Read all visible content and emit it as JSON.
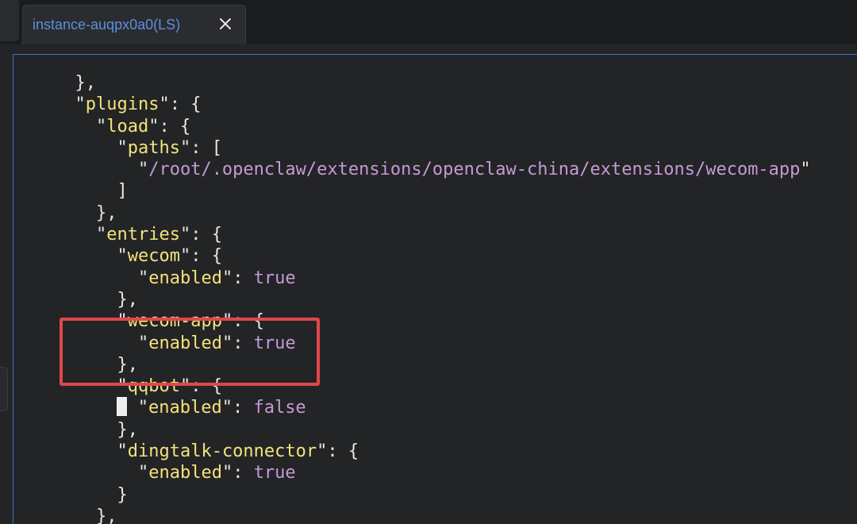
{
  "tab": {
    "title": "instance-auqpx0a0(LS)",
    "close_icon": "close-icon"
  },
  "code_lines": [
    {
      "indent": "  ",
      "parts": [
        {
          "c": "p",
          "t": "},"
        }
      ]
    },
    {
      "indent": "  ",
      "parts": [
        {
          "c": "q",
          "t": "\""
        },
        {
          "c": "k",
          "t": "plugins"
        },
        {
          "c": "q",
          "t": "\""
        },
        {
          "c": "p",
          "t": ": {"
        }
      ]
    },
    {
      "indent": "    ",
      "parts": [
        {
          "c": "q",
          "t": "\""
        },
        {
          "c": "k",
          "t": "load"
        },
        {
          "c": "q",
          "t": "\""
        },
        {
          "c": "p",
          "t": ": {"
        }
      ]
    },
    {
      "indent": "      ",
      "parts": [
        {
          "c": "q",
          "t": "\""
        },
        {
          "c": "k",
          "t": "paths"
        },
        {
          "c": "q",
          "t": "\""
        },
        {
          "c": "p",
          "t": ": ["
        }
      ]
    },
    {
      "indent": "        ",
      "parts": [
        {
          "c": "q",
          "t": "\""
        },
        {
          "c": "s",
          "t": "/root/.openclaw/extensions/openclaw-china/extensions/wecom-app"
        },
        {
          "c": "q",
          "t": "\""
        }
      ]
    },
    {
      "indent": "      ",
      "parts": [
        {
          "c": "p",
          "t": "]"
        }
      ]
    },
    {
      "indent": "    ",
      "parts": [
        {
          "c": "p",
          "t": "},"
        }
      ]
    },
    {
      "indent": "    ",
      "parts": [
        {
          "c": "q",
          "t": "\""
        },
        {
          "c": "k",
          "t": "entries"
        },
        {
          "c": "q",
          "t": "\""
        },
        {
          "c": "p",
          "t": ": {"
        }
      ]
    },
    {
      "indent": "      ",
      "parts": [
        {
          "c": "q",
          "t": "\""
        },
        {
          "c": "k",
          "t": "wecom"
        },
        {
          "c": "q",
          "t": "\""
        },
        {
          "c": "p",
          "t": ": {"
        }
      ]
    },
    {
      "indent": "        ",
      "parts": [
        {
          "c": "q",
          "t": "\""
        },
        {
          "c": "k",
          "t": "enabled"
        },
        {
          "c": "q",
          "t": "\""
        },
        {
          "c": "p",
          "t": ": "
        },
        {
          "c": "v",
          "t": "true"
        }
      ]
    },
    {
      "indent": "      ",
      "parts": [
        {
          "c": "p",
          "t": "},"
        }
      ]
    },
    {
      "indent": "      ",
      "parts": [
        {
          "c": "q",
          "t": "\""
        },
        {
          "c": "k",
          "t": "wecom-app"
        },
        {
          "c": "q",
          "t": "\""
        },
        {
          "c": "p",
          "t": ": {"
        }
      ]
    },
    {
      "indent": "        ",
      "parts": [
        {
          "c": "q",
          "t": "\""
        },
        {
          "c": "k",
          "t": "enabled"
        },
        {
          "c": "q",
          "t": "\""
        },
        {
          "c": "p",
          "t": ": "
        },
        {
          "c": "v",
          "t": "true"
        }
      ]
    },
    {
      "indent": "      ",
      "parts": [
        {
          "c": "p",
          "t": "},"
        }
      ]
    },
    {
      "indent": "      ",
      "parts": [
        {
          "c": "q",
          "t": "\""
        },
        {
          "c": "k",
          "t": "qqbot"
        },
        {
          "c": "q",
          "t": "\""
        },
        {
          "c": "p",
          "t": ": {"
        }
      ]
    },
    {
      "indent": "      ",
      "cursor": true,
      "parts": [
        {
          "c": "p",
          "t": " "
        },
        {
          "c": "q",
          "t": "\""
        },
        {
          "c": "k",
          "t": "enabled"
        },
        {
          "c": "q",
          "t": "\""
        },
        {
          "c": "p",
          "t": ": "
        },
        {
          "c": "v",
          "t": "false"
        }
      ]
    },
    {
      "indent": "      ",
      "parts": [
        {
          "c": "p",
          "t": "},"
        }
      ]
    },
    {
      "indent": "      ",
      "parts": [
        {
          "c": "q",
          "t": "\""
        },
        {
          "c": "k",
          "t": "dingtalk-connector"
        },
        {
          "c": "q",
          "t": "\""
        },
        {
          "c": "p",
          "t": ": {"
        }
      ]
    },
    {
      "indent": "        ",
      "parts": [
        {
          "c": "q",
          "t": "\""
        },
        {
          "c": "k",
          "t": "enabled"
        },
        {
          "c": "q",
          "t": "\""
        },
        {
          "c": "p",
          "t": ": "
        },
        {
          "c": "v",
          "t": "true"
        }
      ]
    },
    {
      "indent": "      ",
      "parts": [
        {
          "c": "p",
          "t": "}"
        }
      ]
    },
    {
      "indent": "    ",
      "parts": [
        {
          "c": "p",
          "t": "},"
        }
      ]
    }
  ],
  "colors": {
    "key": "#f3e37a",
    "value": "#c49ad6",
    "punct": "#e6e6e6",
    "tab_title": "#5b8fe0",
    "highlight_box": "#e0474c",
    "focus_border": "#3f6fcf"
  }
}
